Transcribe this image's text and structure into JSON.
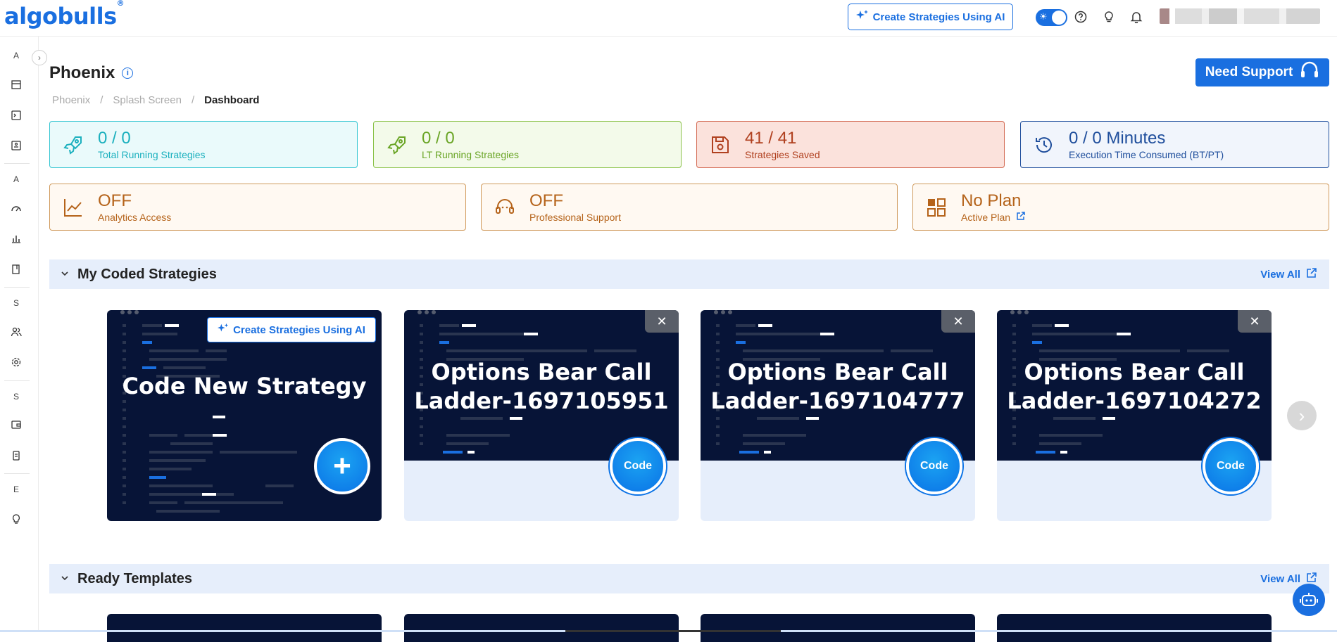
{
  "header": {
    "logo": "algobulls",
    "logo_mark": "®",
    "ai_button": "Create Strategies Using AI"
  },
  "sidebar": {
    "letters": [
      "A",
      "A",
      "S",
      "S",
      "E"
    ]
  },
  "page": {
    "title": "Phoenix",
    "info": "i",
    "need_support": "Need Support",
    "breadcrumb": [
      "Phoenix",
      "/",
      "Splash Screen",
      "/",
      "Dashboard"
    ]
  },
  "stats_row1": [
    {
      "value": "0 / 0",
      "label": "Total Running Strategies"
    },
    {
      "value": "0 / 0",
      "label": "LT Running Strategies"
    },
    {
      "value": "41 / 41",
      "label": "Strategies Saved"
    },
    {
      "value": "0 / 0 Minutes",
      "label": "Execution Time Consumed (BT/PT)"
    }
  ],
  "stats_row2": [
    {
      "value": "OFF",
      "label": "Analytics Access"
    },
    {
      "value": "OFF",
      "label": "Professional Support"
    },
    {
      "value": "No Plan",
      "label": "Active Plan"
    }
  ],
  "coded_section": {
    "title": "My Coded Strategies",
    "view_all": "View All",
    "new_card": {
      "title": "Code New Strategy",
      "ai_button": "Create Strategies Using AI",
      "plus": "+"
    },
    "cards": [
      {
        "line1": "Options Bear Call",
        "line2": "Ladder-1697105951",
        "button": "Code",
        "close": "✕"
      },
      {
        "line1": "Options Bear Call",
        "line2": "Ladder-1697104777",
        "button": "Code",
        "close": "✕"
      },
      {
        "line1": "Options Bear Call",
        "line2": "Ladder-1697104272",
        "button": "Code",
        "close": "✕"
      }
    ]
  },
  "templates_section": {
    "title": "Ready Templates",
    "view_all": "View All"
  },
  "colors": {
    "accent": "#1a6fe0",
    "card_dark": "#071437",
    "section_bg": "#e6eefb"
  }
}
